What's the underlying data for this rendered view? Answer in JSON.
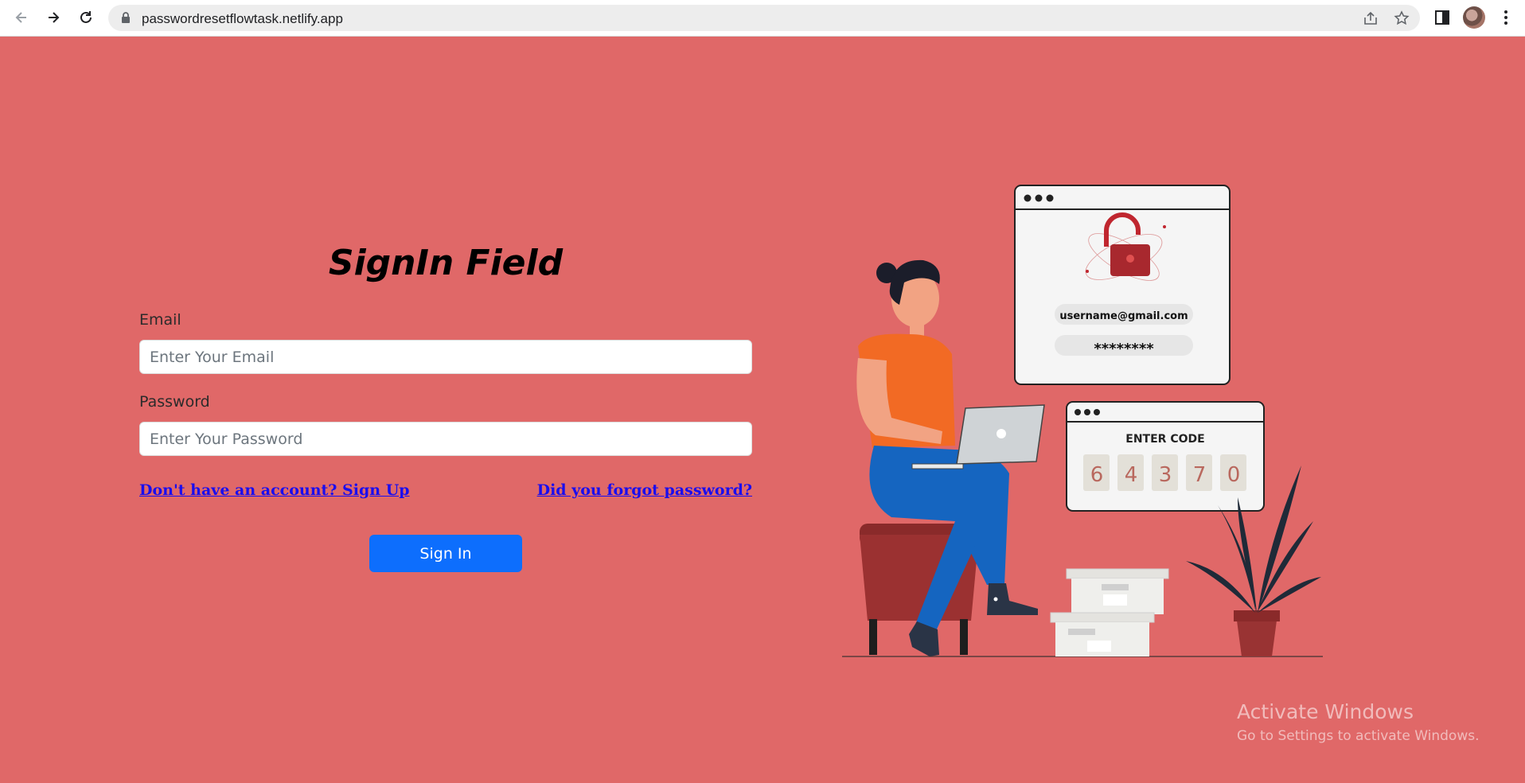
{
  "browser": {
    "url": "passwordresetflowtask.netlify.app"
  },
  "form": {
    "title": "SignIn Field",
    "email_label": "Email",
    "email_placeholder": "Enter Your Email",
    "email_value": "",
    "password_label": "Password",
    "password_placeholder": "Enter Your Password",
    "password_value": "",
    "signup_link": "Don't have an account? Sign Up",
    "forgot_link": "Did you forgot password?",
    "signin_button": "Sign In"
  },
  "illustration": {
    "login_card_email": "username@gmail.com",
    "login_card_password": "********",
    "code_card_title": "ENTER CODE",
    "code_digits": [
      "6",
      "4",
      "3",
      "7",
      "0"
    ]
  },
  "watermark": {
    "title": "Activate Windows",
    "subtitle": "Go to Settings to activate Windows."
  },
  "colors": {
    "background": "#e06868",
    "button": "#0d6efd",
    "link": "#1a0dee"
  }
}
